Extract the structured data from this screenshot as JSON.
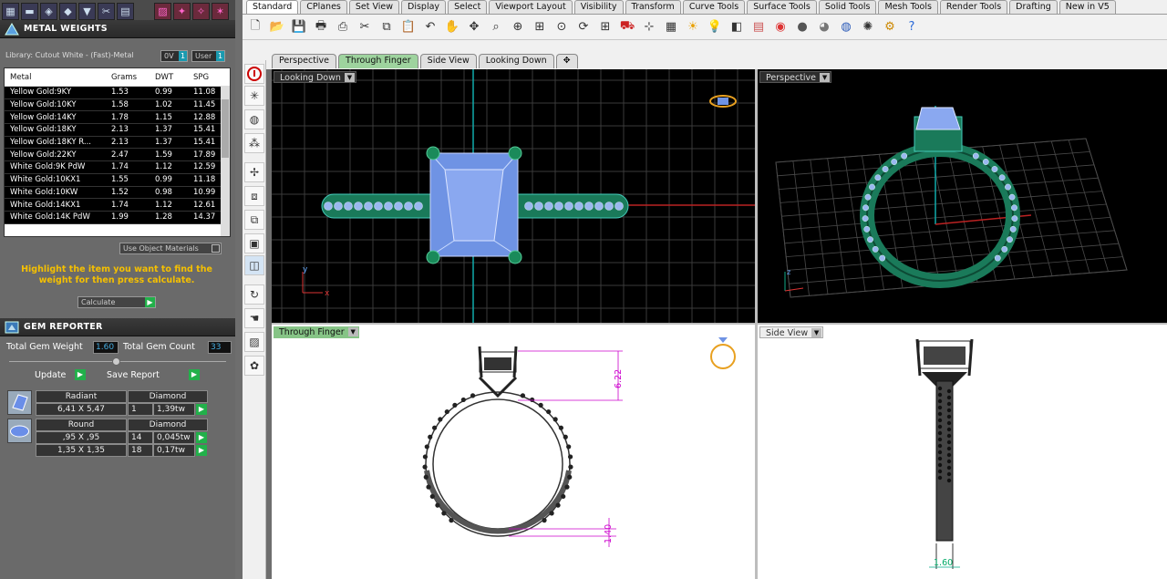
{
  "metal_weights": {
    "title": "METAL WEIGHTS",
    "library": "Library: Cutout White - (Fast)-Metal",
    "chip_ov": "0V",
    "chip_user": "User",
    "chip_tag": "1",
    "columns": [
      "Metal",
      "Grams",
      "DWT",
      "SPG"
    ],
    "rows": [
      {
        "metal": "Yellow Gold:9KY",
        "grams": "1.53",
        "dwt": "0.99",
        "spg": "11.08"
      },
      {
        "metal": "Yellow Gold:10KY",
        "grams": "1.58",
        "dwt": "1.02",
        "spg": "11.45"
      },
      {
        "metal": "Yellow Gold:14KY",
        "grams": "1.78",
        "dwt": "1.15",
        "spg": "12.88"
      },
      {
        "metal": "Yellow Gold:18KY",
        "grams": "2.13",
        "dwt": "1.37",
        "spg": "15.41"
      },
      {
        "metal": "Yellow Gold:18KY R...",
        "grams": "2.13",
        "dwt": "1.37",
        "spg": "15.41"
      },
      {
        "metal": "Yellow Gold:22KY",
        "grams": "2.47",
        "dwt": "1.59",
        "spg": "17.89"
      },
      {
        "metal": "White Gold:9K PdW",
        "grams": "1.74",
        "dwt": "1.12",
        "spg": "12.59"
      },
      {
        "metal": "White Gold:10KX1",
        "grams": "1.55",
        "dwt": "0.99",
        "spg": "11.18"
      },
      {
        "metal": "White Gold:10KW",
        "grams": "1.52",
        "dwt": "0.98",
        "spg": "10.99"
      },
      {
        "metal": "White Gold:14KX1",
        "grams": "1.74",
        "dwt": "1.12",
        "spg": "12.61"
      },
      {
        "metal": "White Gold:14K PdW",
        "grams": "1.99",
        "dwt": "1.28",
        "spg": "14.37"
      }
    ],
    "use_object_materials": "Use Object Materials",
    "hint": "Highlight the item you want to find the weight for then press calculate.",
    "calculate_label": "Calculate"
  },
  "gem_reporter": {
    "title": "GEM REPORTER",
    "total_weight_label": "Total Gem Weight",
    "total_weight_value": "1.60",
    "total_count_label": "Total Gem Count",
    "total_count_value": "33",
    "update_label": "Update",
    "save_report_label": "Save Report",
    "gems": [
      {
        "cut": "Radiant",
        "type": "Diamond",
        "size": "6,41 X 5,47",
        "qty": "1",
        "weight": "1,39tw"
      },
      {
        "cut": "Round",
        "type": "Diamond",
        "size": ",95 X ,95",
        "qty": "14",
        "weight": "0,045tw"
      },
      {
        "cut": "",
        "type": "",
        "size": "1,35 X 1,35",
        "qty": "18",
        "weight": "0,17tw"
      }
    ]
  },
  "toolbar_tabs": [
    "Standard",
    "CPlanes",
    "Set View",
    "Display",
    "Select",
    "Viewport Layout",
    "Visibility",
    "Transform",
    "Curve Tools",
    "Surface Tools",
    "Solid Tools",
    "Mesh Tools",
    "Render Tools",
    "Drafting",
    "New in V5"
  ],
  "toolbar_icons": [
    "new-file-icon",
    "open-folder-icon",
    "save-icon",
    "print-icon",
    "import-icon",
    "cut-icon",
    "copy-icon",
    "paste-icon",
    "undo-icon",
    "pan-hand-icon",
    "move-icon",
    "zoom-dynamic-icon",
    "zoom-extents-icon",
    "zoom-window-icon",
    "zoom-selected-icon",
    "rotate-view-icon",
    "four-viewports-icon",
    "car-icon",
    "snap-icon",
    "grid-icon",
    "sun-icon",
    "lightbulb-icon",
    "layer-icon",
    "properties-icon",
    "color-wheel-icon",
    "sphere-icon",
    "render-sphere-icon",
    "blue-sphere-icon",
    "light-icon",
    "gear-icon",
    "help-icon"
  ],
  "view_tabs": [
    "Perspective",
    "Through Finger",
    "Side View",
    "Looking Down"
  ],
  "viewports": {
    "top_left": "Looking Down",
    "top_right": "Perspective",
    "bottom_left": "Through Finger",
    "bottom_right": "Side View"
  },
  "dimensions": {
    "head_height": "6.22",
    "shank_thickness": "1.40",
    "shank_width": "1.60"
  },
  "axes": {
    "x": "x",
    "y": "y",
    "z": "z"
  }
}
